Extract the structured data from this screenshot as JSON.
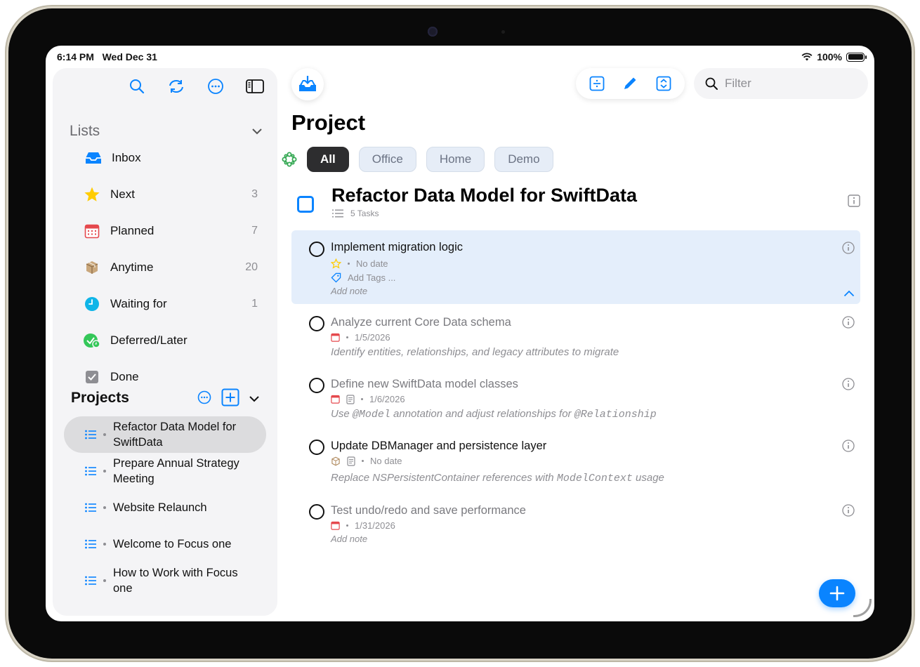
{
  "status": {
    "time": "6:14 PM",
    "date": "Wed Dec 31",
    "battery": "100%"
  },
  "sidebar": {
    "lists_title": "Lists",
    "lists": [
      {
        "label": "Inbox",
        "count": ""
      },
      {
        "label": "Next",
        "count": "3"
      },
      {
        "label": "Planned",
        "count": "7"
      },
      {
        "label": "Anytime",
        "count": "20"
      },
      {
        "label": "Waiting for",
        "count": "1"
      },
      {
        "label": "Deferred/Later",
        "count": ""
      },
      {
        "label": "Done",
        "count": ""
      }
    ],
    "projects_title": "Projects",
    "projects": [
      {
        "label": "Refactor Data Model for SwiftData",
        "selected": true
      },
      {
        "label": "Prepare Annual Strategy Meeting",
        "selected": false
      },
      {
        "label": "Website Relaunch",
        "selected": false
      },
      {
        "label": "Welcome to Focus one",
        "selected": false
      },
      {
        "label": "How to Work with Focus one",
        "selected": false
      }
    ]
  },
  "toolbar": {
    "filter_placeholder": "Filter"
  },
  "main": {
    "title": "Project",
    "tags": [
      "All",
      "Office",
      "Home",
      "Demo"
    ],
    "active_tag": "All",
    "project": {
      "name": "Refactor Data Model for SwiftData",
      "task_count": "5 Tasks"
    },
    "tasks": [
      {
        "title": "Implement migration logic",
        "date": "No date",
        "tags_hint": "Add Tags ...",
        "note": "Add note"
      },
      {
        "title": "Analyze current Core Data schema",
        "date": "1/5/2026",
        "note": "Identify entities, relationships, and legacy attributes to migrate"
      },
      {
        "title": "Define new SwiftData model classes",
        "date": "1/6/2026",
        "note_pre": "Use ",
        "note_code1": "@Model",
        "note_mid": " annotation and adjust relationships for ",
        "note_code2": "@Relationship"
      },
      {
        "title": "Update DBManager and persistence layer",
        "date": "No date",
        "note_pre": "Replace NSPersistentContainer references with ",
        "note_code1": "ModelContext",
        "note_post": " usage"
      },
      {
        "title": "Test undo/redo and save performance",
        "date": "1/31/2026",
        "note": "Add note"
      }
    ]
  },
  "colors": {
    "accent": "#0a84ff",
    "highlight": "#e4eefb",
    "sidebar_bg": "#f4f4f6"
  }
}
